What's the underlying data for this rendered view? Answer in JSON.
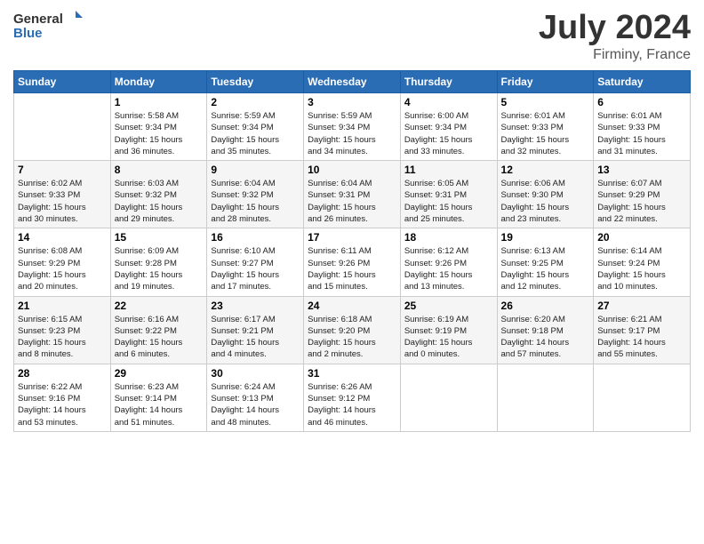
{
  "header": {
    "logo_general": "General",
    "logo_blue": "Blue",
    "title": "July 2024",
    "location": "Firminy, France"
  },
  "days_of_week": [
    "Sunday",
    "Monday",
    "Tuesday",
    "Wednesday",
    "Thursday",
    "Friday",
    "Saturday"
  ],
  "weeks": [
    [
      {
        "day": "",
        "info": ""
      },
      {
        "day": "1",
        "info": "Sunrise: 5:58 AM\nSunset: 9:34 PM\nDaylight: 15 hours\nand 36 minutes."
      },
      {
        "day": "2",
        "info": "Sunrise: 5:59 AM\nSunset: 9:34 PM\nDaylight: 15 hours\nand 35 minutes."
      },
      {
        "day": "3",
        "info": "Sunrise: 5:59 AM\nSunset: 9:34 PM\nDaylight: 15 hours\nand 34 minutes."
      },
      {
        "day": "4",
        "info": "Sunrise: 6:00 AM\nSunset: 9:34 PM\nDaylight: 15 hours\nand 33 minutes."
      },
      {
        "day": "5",
        "info": "Sunrise: 6:01 AM\nSunset: 9:33 PM\nDaylight: 15 hours\nand 32 minutes."
      },
      {
        "day": "6",
        "info": "Sunrise: 6:01 AM\nSunset: 9:33 PM\nDaylight: 15 hours\nand 31 minutes."
      }
    ],
    [
      {
        "day": "7",
        "info": "Sunrise: 6:02 AM\nSunset: 9:33 PM\nDaylight: 15 hours\nand 30 minutes."
      },
      {
        "day": "8",
        "info": "Sunrise: 6:03 AM\nSunset: 9:32 PM\nDaylight: 15 hours\nand 29 minutes."
      },
      {
        "day": "9",
        "info": "Sunrise: 6:04 AM\nSunset: 9:32 PM\nDaylight: 15 hours\nand 28 minutes."
      },
      {
        "day": "10",
        "info": "Sunrise: 6:04 AM\nSunset: 9:31 PM\nDaylight: 15 hours\nand 26 minutes."
      },
      {
        "day": "11",
        "info": "Sunrise: 6:05 AM\nSunset: 9:31 PM\nDaylight: 15 hours\nand 25 minutes."
      },
      {
        "day": "12",
        "info": "Sunrise: 6:06 AM\nSunset: 9:30 PM\nDaylight: 15 hours\nand 23 minutes."
      },
      {
        "day": "13",
        "info": "Sunrise: 6:07 AM\nSunset: 9:29 PM\nDaylight: 15 hours\nand 22 minutes."
      }
    ],
    [
      {
        "day": "14",
        "info": "Sunrise: 6:08 AM\nSunset: 9:29 PM\nDaylight: 15 hours\nand 20 minutes."
      },
      {
        "day": "15",
        "info": "Sunrise: 6:09 AM\nSunset: 9:28 PM\nDaylight: 15 hours\nand 19 minutes."
      },
      {
        "day": "16",
        "info": "Sunrise: 6:10 AM\nSunset: 9:27 PM\nDaylight: 15 hours\nand 17 minutes."
      },
      {
        "day": "17",
        "info": "Sunrise: 6:11 AM\nSunset: 9:26 PM\nDaylight: 15 hours\nand 15 minutes."
      },
      {
        "day": "18",
        "info": "Sunrise: 6:12 AM\nSunset: 9:26 PM\nDaylight: 15 hours\nand 13 minutes."
      },
      {
        "day": "19",
        "info": "Sunrise: 6:13 AM\nSunset: 9:25 PM\nDaylight: 15 hours\nand 12 minutes."
      },
      {
        "day": "20",
        "info": "Sunrise: 6:14 AM\nSunset: 9:24 PM\nDaylight: 15 hours\nand 10 minutes."
      }
    ],
    [
      {
        "day": "21",
        "info": "Sunrise: 6:15 AM\nSunset: 9:23 PM\nDaylight: 15 hours\nand 8 minutes."
      },
      {
        "day": "22",
        "info": "Sunrise: 6:16 AM\nSunset: 9:22 PM\nDaylight: 15 hours\nand 6 minutes."
      },
      {
        "day": "23",
        "info": "Sunrise: 6:17 AM\nSunset: 9:21 PM\nDaylight: 15 hours\nand 4 minutes."
      },
      {
        "day": "24",
        "info": "Sunrise: 6:18 AM\nSunset: 9:20 PM\nDaylight: 15 hours\nand 2 minutes."
      },
      {
        "day": "25",
        "info": "Sunrise: 6:19 AM\nSunset: 9:19 PM\nDaylight: 15 hours\nand 0 minutes."
      },
      {
        "day": "26",
        "info": "Sunrise: 6:20 AM\nSunset: 9:18 PM\nDaylight: 14 hours\nand 57 minutes."
      },
      {
        "day": "27",
        "info": "Sunrise: 6:21 AM\nSunset: 9:17 PM\nDaylight: 14 hours\nand 55 minutes."
      }
    ],
    [
      {
        "day": "28",
        "info": "Sunrise: 6:22 AM\nSunset: 9:16 PM\nDaylight: 14 hours\nand 53 minutes."
      },
      {
        "day": "29",
        "info": "Sunrise: 6:23 AM\nSunset: 9:14 PM\nDaylight: 14 hours\nand 51 minutes."
      },
      {
        "day": "30",
        "info": "Sunrise: 6:24 AM\nSunset: 9:13 PM\nDaylight: 14 hours\nand 48 minutes."
      },
      {
        "day": "31",
        "info": "Sunrise: 6:26 AM\nSunset: 9:12 PM\nDaylight: 14 hours\nand 46 minutes."
      },
      {
        "day": "",
        "info": ""
      },
      {
        "day": "",
        "info": ""
      },
      {
        "day": "",
        "info": ""
      }
    ]
  ]
}
